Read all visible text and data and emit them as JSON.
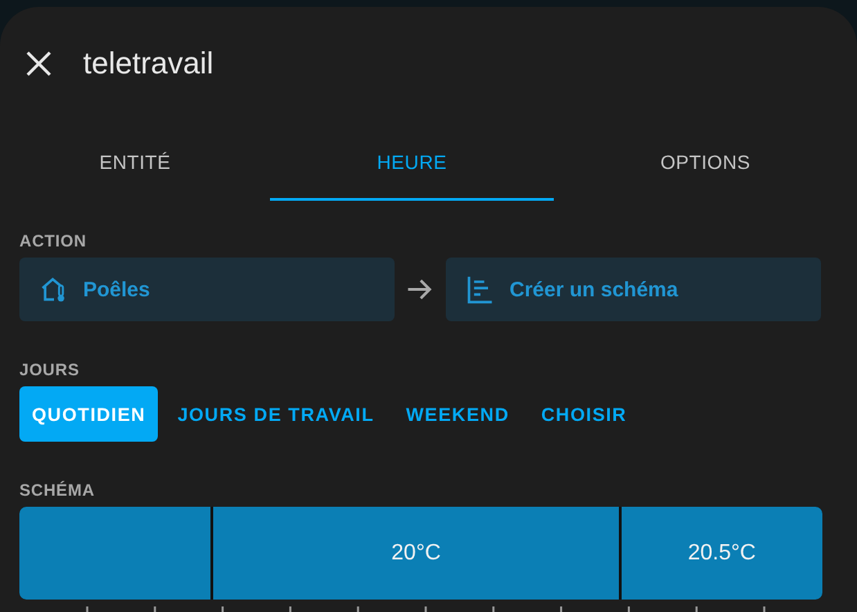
{
  "dialog": {
    "title": "teletravail"
  },
  "tabs": [
    {
      "label": "ENTITÉ",
      "selected": false
    },
    {
      "label": "HEURE",
      "selected": true
    },
    {
      "label": "OPTIONS",
      "selected": false
    }
  ],
  "action": {
    "label": "ACTION",
    "source": "Poêles",
    "target": "Créer un schéma"
  },
  "days": {
    "label": "JOURS",
    "options": [
      {
        "label": "QUOTIDIEN",
        "selected": true
      },
      {
        "label": "JOURS DE TRAVAIL",
        "selected": false
      },
      {
        "label": "WEEKEND",
        "selected": false
      },
      {
        "label": "CHOISIR",
        "selected": false
      }
    ]
  },
  "schema": {
    "label": "SCHÉMA",
    "segments": [
      {
        "label": "20°C"
      },
      {
        "label": "20.5°C"
      }
    ]
  }
}
